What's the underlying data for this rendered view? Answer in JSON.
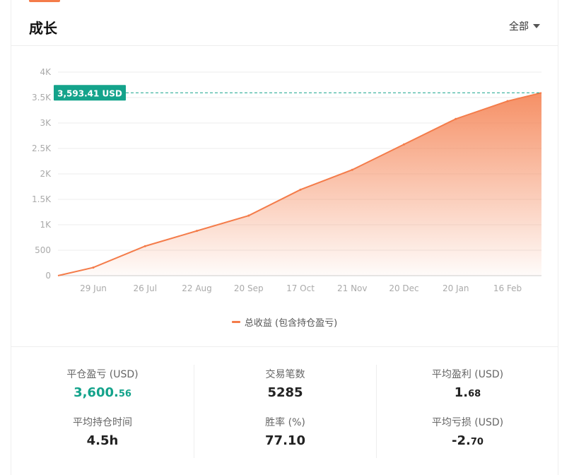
{
  "header": {
    "title": "成长",
    "filter_label": "全部"
  },
  "colors": {
    "accent": "#f47c4a",
    "positive": "#14a38b",
    "grid": "#eeeeee",
    "axis_text": "#aaaaaa"
  },
  "current_value_label": "3,593.41 USD",
  "chart_data": {
    "type": "area",
    "title": "",
    "xlabel": "",
    "ylabel": "",
    "ylim": [
      0,
      4000
    ],
    "y_ticks": [
      "0",
      "500",
      "1K",
      "1.5K",
      "2K",
      "2.5K",
      "3K",
      "3.5K",
      "4K"
    ],
    "x_ticks": [
      "29 Jun",
      "26 Jul",
      "22 Aug",
      "20 Sep",
      "17 Oct",
      "21 Nov",
      "20 Dec",
      "20 Jan",
      "16 Feb"
    ],
    "grid": true,
    "legend_position": "bottom",
    "series": [
      {
        "name": "总收益 (包含持仓盈亏)",
        "color": "#f47c4a",
        "x": [
          "29 Jun",
          "26 Jul",
          "22 Aug",
          "20 Sep",
          "17 Oct",
          "21 Nov",
          "20 Dec",
          "20 Jan",
          "16 Feb"
        ],
        "y": [
          160,
          580,
          880,
          1180,
          1690,
          2080,
          2580,
          3080,
          3430
        ]
      }
    ],
    "reference_line": {
      "value": 3593.41,
      "style": "dashed"
    }
  },
  "stats": [
    {
      "label": "平仓盈亏 (USD)",
      "main": "3,600.",
      "small": "56",
      "positive": true
    },
    {
      "label": "交易笔数",
      "main": "5285",
      "small": "",
      "positive": false
    },
    {
      "label": "平均盈利 (USD)",
      "main": "1.",
      "small": "68",
      "positive": false
    },
    {
      "label": "平均持仓时间",
      "main": "4.5h",
      "small": "",
      "positive": false
    },
    {
      "label": "胜率 (%)",
      "main": "77.10",
      "small": "",
      "positive": false
    },
    {
      "label": "平均亏损 (USD)",
      "main": "-2.",
      "small": "70",
      "positive": false
    }
  ]
}
